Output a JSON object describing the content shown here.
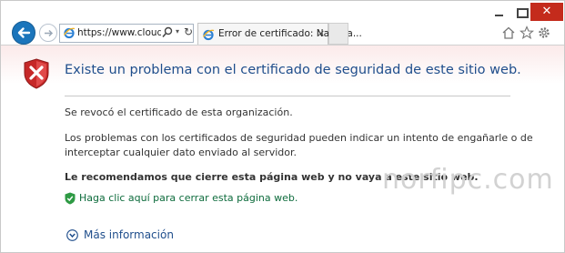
{
  "browser": {
    "address_url": "https://www.cloudfla",
    "tab_title": "Error de certificado: Navega...",
    "tab_close": "×",
    "close_glyph": "✕",
    "refresh_glyph": "↻",
    "dropdown_glyph": "▾",
    "icons": [
      "back-arrow-icon",
      "forward-arrow-icon",
      "ie-logo-icon",
      "search-icon",
      "home-icon",
      "star-icon",
      "gear-icon"
    ]
  },
  "page": {
    "heading": "Existe un problema con el certificado de seguridad de este sitio web.",
    "revoked": "Se revocó el certificado de esta organización.",
    "explanation": "Los problemas con los certificados de seguridad pueden indicar un intento de engañarle o de interceptar cualquier dato enviado al servidor.",
    "recommendation": "Le recomendamos que cierre esta página web y no vaya a este sitio web.",
    "close_link": "Haga clic aquí para cerrar esta página web.",
    "more_info": "Más información"
  },
  "watermark": "norfipc.com",
  "colors": {
    "heading": "#1f4e8c",
    "link_green": "#0d6b3c",
    "close_button": "#c42b1c",
    "back_button": "#1b75bb"
  }
}
